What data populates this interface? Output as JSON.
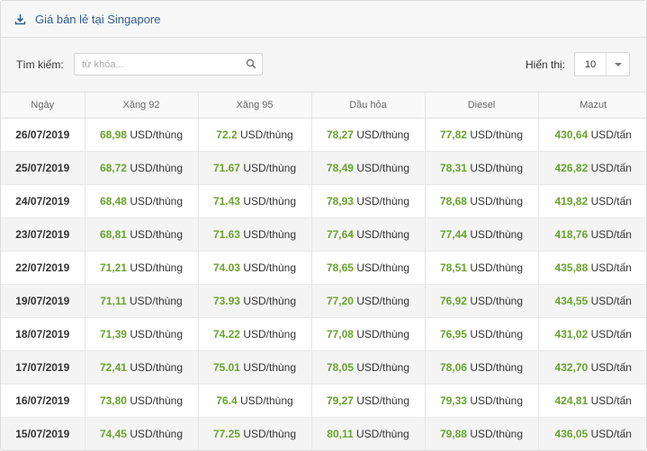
{
  "header": {
    "title": "Giá bán lẻ tại Singapore",
    "icon": "download-icon"
  },
  "controls": {
    "search_label": "Tìm kiếm:",
    "search_placeholder": "từ khóa...",
    "show_label": "Hiển thị:",
    "page_size": "10"
  },
  "table": {
    "columns": [
      "Ngày",
      "Xăng 92",
      "Xăng 95",
      "Dầu hỏa",
      "Diesel",
      "Mazut"
    ],
    "rows": [
      {
        "date": "26/07/2019",
        "x92": "68,98",
        "x95": "72.2",
        "dh": "78,27",
        "ds": "77,82",
        "mz": "430,64"
      },
      {
        "date": "25/07/2019",
        "x92": "68,72",
        "x95": "71.67",
        "dh": "78,49",
        "ds": "78,31",
        "mz": "426,82"
      },
      {
        "date": "24/07/2019",
        "x92": "68,48",
        "x95": "71.43",
        "dh": "78,93",
        "ds": "78,68",
        "mz": "419,82"
      },
      {
        "date": "23/07/2019",
        "x92": "68,81",
        "x95": "71.63",
        "dh": "77,64",
        "ds": "77,44",
        "mz": "418,76"
      },
      {
        "date": "22/07/2019",
        "x92": "71,21",
        "x95": "74.03",
        "dh": "78,65",
        "ds": "78,51",
        "mz": "435,88"
      },
      {
        "date": "19/07/2019",
        "x92": "71,11",
        "x95": "73.93",
        "dh": "77,20",
        "ds": "76,92",
        "mz": "434,55"
      },
      {
        "date": "18/07/2019",
        "x92": "71,39",
        "x95": "74.22",
        "dh": "77,08",
        "ds": "76,95",
        "mz": "431,02"
      },
      {
        "date": "17/07/2019",
        "x92": "72,41",
        "x95": "75.01",
        "dh": "78,05",
        "ds": "78,06",
        "mz": "432,70"
      },
      {
        "date": "16/07/2019",
        "x92": "73,80",
        "x95": "76.4",
        "dh": "79,27",
        "ds": "79,33",
        "mz": "424,81"
      },
      {
        "date": "15/07/2019",
        "x92": "74,45",
        "x95": "77.25",
        "dh": "80,11",
        "ds": "79,88",
        "mz": "436,05"
      }
    ],
    "unit_barrel": "USD/thùng",
    "unit_ton": "USD/tấn"
  },
  "colors": {
    "value_green": "#6aa22e",
    "title_blue": "#2f5f8f"
  }
}
